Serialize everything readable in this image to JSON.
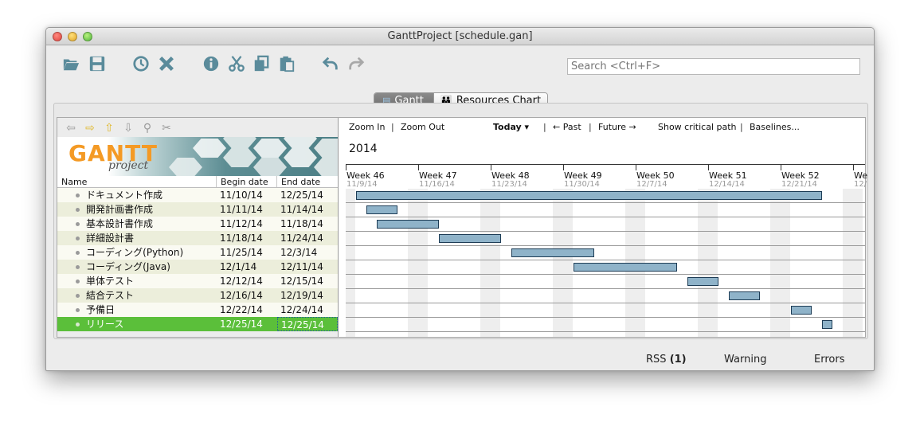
{
  "window": {
    "title": "GanttProject [schedule.gan]"
  },
  "toolbar": {
    "icons": [
      "folder-open-icon",
      "save-icon",
      "history-icon",
      "delete-icon",
      "info-icon",
      "cut-icon",
      "copy-icon",
      "paste-icon",
      "undo-icon",
      "redo-icon"
    ],
    "search_placeholder": "Search <Ctrl+F>"
  },
  "tabs": [
    {
      "label": "Gantt",
      "active": true
    },
    {
      "label": "Resources Chart",
      "active": false
    }
  ],
  "logo": {
    "title": "GANTT",
    "subtitle": "project"
  },
  "task_table": {
    "columns": [
      "Name",
      "Begin date",
      "End date"
    ],
    "rows": [
      {
        "name": "ドキュメント作成",
        "begin": "11/10/14",
        "end": "12/25/14"
      },
      {
        "name": "開発計画書作成",
        "begin": "11/11/14",
        "end": "11/14/14"
      },
      {
        "name": "基本設計書作成",
        "begin": "11/12/14",
        "end": "11/18/14"
      },
      {
        "name": "詳細設計書",
        "begin": "11/18/14",
        "end": "11/24/14"
      },
      {
        "name": "コーディング(Python)",
        "begin": "11/25/14",
        "end": "12/3/14"
      },
      {
        "name": "コーディング(Java)",
        "begin": "12/1/14",
        "end": "12/11/14"
      },
      {
        "name": "単体テスト",
        "begin": "12/12/14",
        "end": "12/15/14"
      },
      {
        "name": "結合テスト",
        "begin": "12/16/14",
        "end": "12/19/14"
      },
      {
        "name": "予備日",
        "begin": "12/22/14",
        "end": "12/24/14"
      },
      {
        "name": "リリース",
        "begin": "12/25/14",
        "end": "12/25/14",
        "selected": true
      }
    ]
  },
  "gantt_toolbar": {
    "zoom_in": "Zoom In",
    "zoom_out": "Zoom Out",
    "today": "Today ▾",
    "past": "← Past",
    "future": "Future →",
    "critical_path": "Show critical path",
    "baselines": "Baselines...",
    "separator": "|"
  },
  "timeline": {
    "year": "2014",
    "weeks": [
      {
        "label": "Week 46",
        "date": "11/9/14"
      },
      {
        "label": "Week 47",
        "date": "11/16/14"
      },
      {
        "label": "Week 48",
        "date": "11/23/14"
      },
      {
        "label": "Week 49",
        "date": "11/30/14"
      },
      {
        "label": "Week 50",
        "date": "12/7/14"
      },
      {
        "label": "Week 51",
        "date": "12/14/14"
      },
      {
        "label": "Week 52",
        "date": "12/21/14"
      },
      {
        "label": "We",
        "date": "12/"
      }
    ]
  },
  "statusbar": {
    "rss": "RSS",
    "rss_count": "(1)",
    "warning": "Warning",
    "errors": "Errors"
  },
  "colors": {
    "bar_fill": "#8fb3c9",
    "bar_border": "#1d3c55",
    "selected_row": "#5bbf3a",
    "toolbar_icon": "#5a8b9b"
  }
}
